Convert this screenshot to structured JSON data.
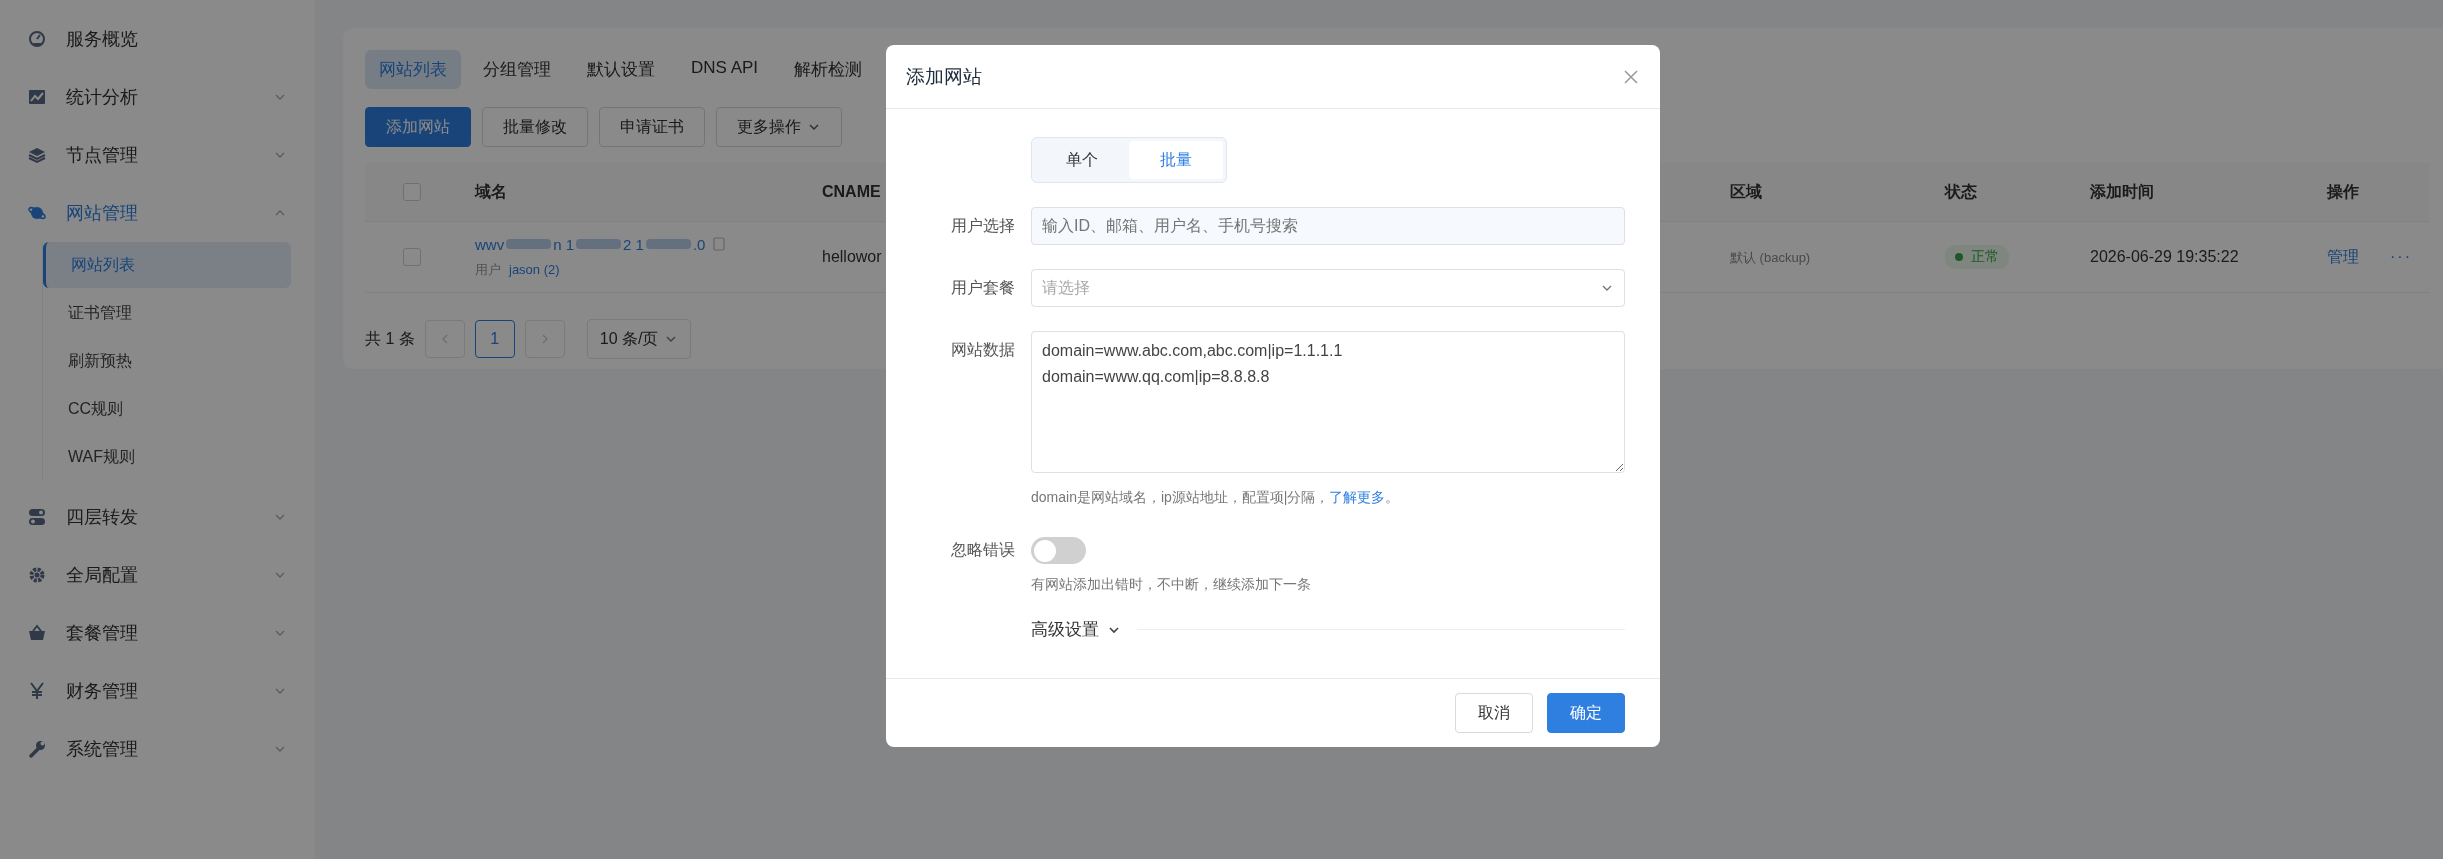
{
  "sidebar": {
    "items": [
      {
        "label": "服务概览",
        "selected": false
      },
      {
        "label": "统计分析",
        "selected": false,
        "expanded": false
      },
      {
        "label": "节点管理",
        "selected": false,
        "expanded": false
      },
      {
        "label": "网站管理",
        "selected": true,
        "expanded": true,
        "children": [
          {
            "label": "网站列表",
            "selected": true
          },
          {
            "label": "证书管理",
            "selected": false
          },
          {
            "label": "刷新预热",
            "selected": false
          },
          {
            "label": "CC规则",
            "selected": false
          },
          {
            "label": "WAF规则",
            "selected": false
          }
        ]
      },
      {
        "label": "四层转发",
        "selected": false,
        "expanded": false
      },
      {
        "label": "全局配置",
        "selected": false,
        "expanded": false
      },
      {
        "label": "套餐管理",
        "selected": false,
        "expanded": false
      },
      {
        "label": "财务管理",
        "selected": false,
        "expanded": false
      },
      {
        "label": "系统管理",
        "selected": false,
        "expanded": false
      }
    ]
  },
  "tabs": [
    {
      "label": "网站列表",
      "selected": true
    },
    {
      "label": "分组管理",
      "selected": false
    },
    {
      "label": "默认设置",
      "selected": false
    },
    {
      "label": "DNS API",
      "selected": false
    },
    {
      "label": "解析检测",
      "selected": false
    }
  ],
  "toolbar": [
    {
      "label": "添加网站",
      "kind": "primary"
    },
    {
      "label": "批量修改",
      "kind": "default"
    },
    {
      "label": "申请证书",
      "kind": "default"
    },
    {
      "label": "更多操作",
      "kind": "dropdown"
    }
  ],
  "table": {
    "select_all": {
      "checked": false
    },
    "columns": [
      {
        "label": "域名",
        "kind": "domain"
      },
      {
        "label": "CNAME",
        "kind": "cname"
      },
      {
        "label": "区域",
        "kind": "region"
      },
      {
        "label": "状态",
        "kind": "status"
      },
      {
        "label": "添加时间",
        "kind": "time"
      },
      {
        "label": "操作",
        "kind": "actions"
      }
    ],
    "rows": [
      {
        "checked": false,
        "domain_parts": [
          "wwv",
          "n 1",
          "2 1",
          ".0"
        ],
        "user_label": "用户",
        "user": "jason (2)",
        "cname": "hellowor",
        "region": "默认 (backup)",
        "status": "正常",
        "time": "2026-06-29 19:35:22",
        "action": "管理",
        "more": "···"
      }
    ]
  },
  "pagination": {
    "total": "共 1 条",
    "pages": [
      {
        "label": "1",
        "selected": true
      }
    ],
    "page_size": "10 条/页"
  },
  "dialog": {
    "title": "添加网站",
    "modes": [
      {
        "label": "单个",
        "selected": false
      },
      {
        "label": "批量",
        "selected": true
      }
    ],
    "fields": [
      {
        "kind": "input",
        "label": "用户选择",
        "placeholder": "输入ID、邮箱、用户名、手机号搜索"
      },
      {
        "kind": "select",
        "label": "用户套餐",
        "placeholder": "请选择"
      },
      {
        "kind": "textarea",
        "label": "网站数据",
        "value": "domain=www.abc.com,abc.com|ip=1.1.1.1\ndomain=www.qq.com|ip=8.8.8.8",
        "help": "domain是网站域名，ip源站地址，配置项|分隔，",
        "help_link": "了解更多",
        "help_end": "。"
      },
      {
        "kind": "switch",
        "label": "忽略错误",
        "on": false,
        "help": "有网站添加出错时，不中断，继续添加下一条"
      }
    ],
    "advanced": {
      "label": "高级设置",
      "expanded": false
    },
    "buttons": [
      {
        "label": "取消",
        "kind": "default"
      },
      {
        "label": "确定",
        "kind": "primary"
      }
    ]
  }
}
